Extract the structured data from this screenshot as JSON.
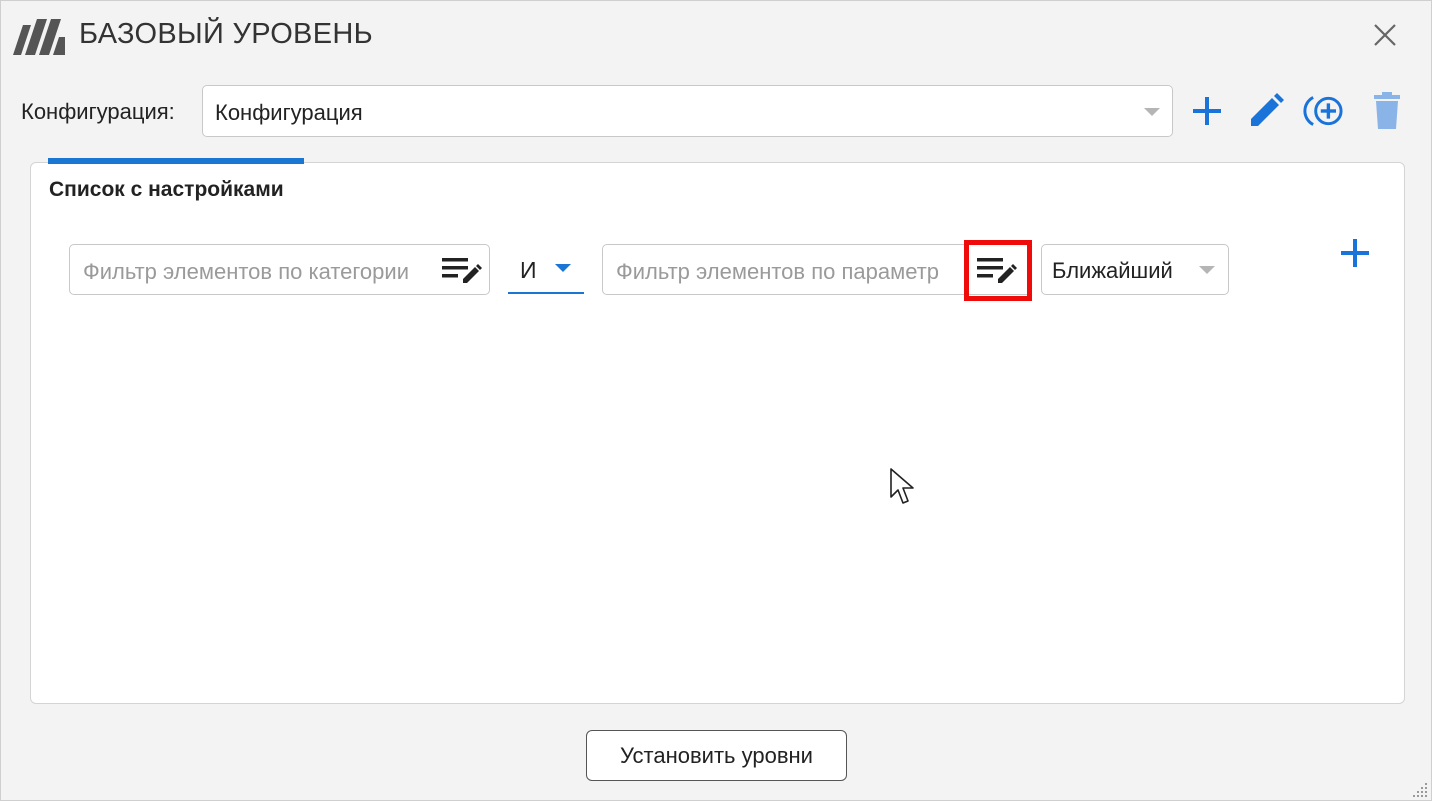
{
  "window": {
    "title": "БАЗОВЫЙ УРОВЕНЬ",
    "logo_icon": "brand-logo-icon",
    "close_icon": "close-icon"
  },
  "config": {
    "label": "Конфигурация:",
    "selected_value": "Конфигурация",
    "toolbar_icons": [
      "add-icon",
      "edit-pencil-icon",
      "add-circle-icon",
      "trash-icon"
    ]
  },
  "panel": {
    "title": "Список с настройками",
    "row": {
      "category_filter_placeholder": "Фильтр элементов по категории",
      "logic_operator": "И",
      "parameter_filter_placeholder": "Фильтр элементов по параметр",
      "near_select_value": "Ближайший"
    }
  },
  "footer": {
    "set_levels_label": "Установить уровни"
  },
  "colors": {
    "accent": "#1976d2",
    "highlight": "#f00b0b",
    "toolbar_blue": "#1a73d9",
    "trash_blue": "#8ab4e8"
  }
}
